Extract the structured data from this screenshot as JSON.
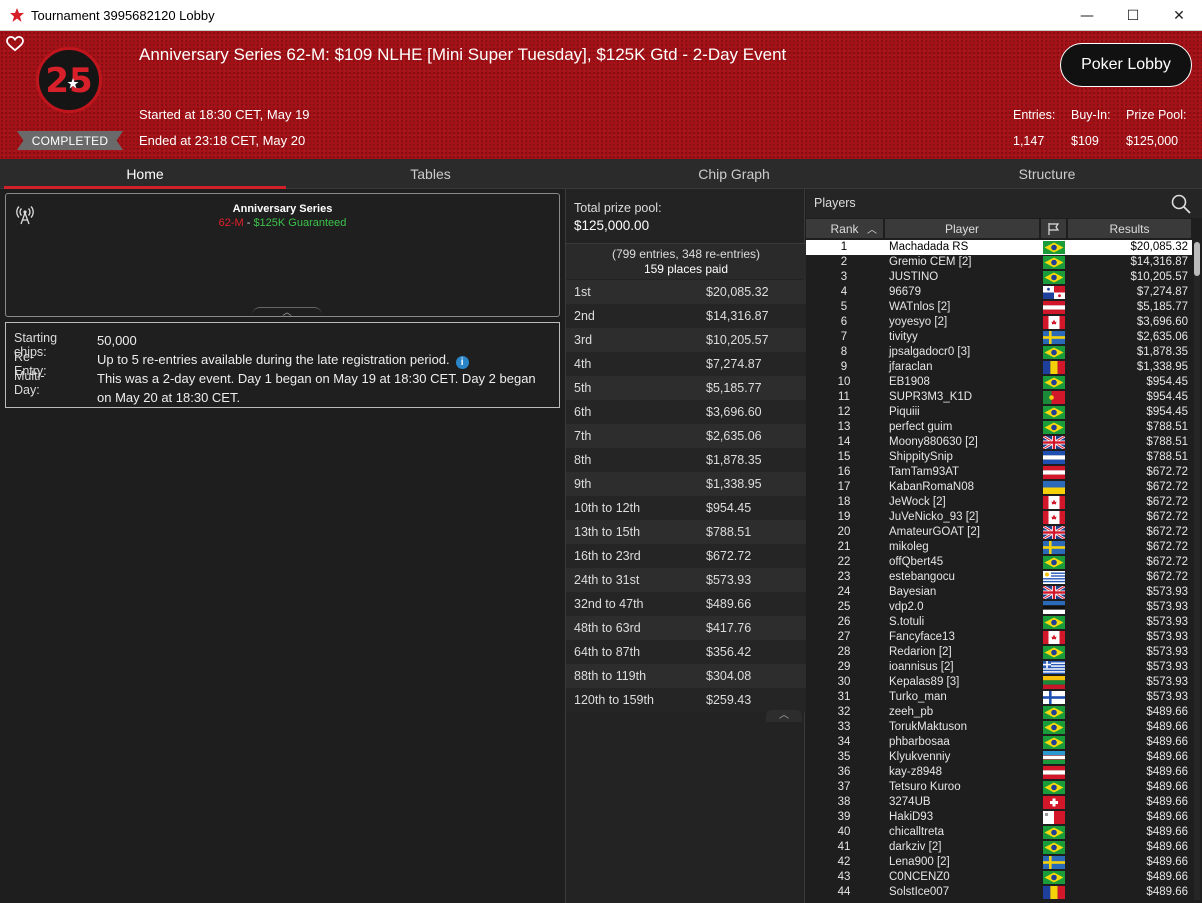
{
  "window": {
    "title": "Tournament 3995682120 Lobby",
    "minimize": "—",
    "maximize": "☐",
    "close": "✕"
  },
  "header": {
    "title": "Anniversary Series 62-M: $109 NLHE [Mini Super Tuesday], $125K Gtd - 2-Day Event",
    "logo_text": "25",
    "status_badge": "COMPLETED",
    "started": "Started at 18:30 CET, May 19",
    "ended": "Ended at 23:18 CET, May 20",
    "poker_lobby_button": "Poker Lobby",
    "entries_label": "Entries:",
    "entries_value": "1,147",
    "buyin_label": "Buy-In:",
    "buyin_value": "$109",
    "prizepool_label": "Prize Pool:",
    "prizepool_value": "$125,000"
  },
  "tabs": [
    "Home",
    "Tables",
    "Chip Graph",
    "Structure"
  ],
  "series": {
    "name": "Anniversary Series",
    "code": "62-M",
    "separator": " - ",
    "guarantee": "$125K Guaranteed"
  },
  "info": {
    "starting_chips_label": "Starting chips:",
    "starting_chips_value": "50,000",
    "reentry_label": "Re-Entry:",
    "reentry_value": "Up to 5 re-entries available during the late registration period.",
    "multiday_label": "Multi-Day:",
    "multiday_value": "This was a 2-day event. Day 1 began on May 19 at 18:30 CET. Day 2 began on May 20 at 18:30 CET."
  },
  "prize_pool": {
    "label": "Total prize pool:",
    "value": "$125,000.00",
    "entries_text": "(799 entries, 348 re-entries)",
    "places_paid": "159 places paid",
    "payouts": [
      {
        "place": "1st",
        "amount": "$20,085.32"
      },
      {
        "place": "2nd",
        "amount": "$14,316.87"
      },
      {
        "place": "3rd",
        "amount": "$10,205.57"
      },
      {
        "place": "4th",
        "amount": "$7,274.87"
      },
      {
        "place": "5th",
        "amount": "$5,185.77"
      },
      {
        "place": "6th",
        "amount": "$3,696.60"
      },
      {
        "place": "7th",
        "amount": "$2,635.06"
      },
      {
        "place": "8th",
        "amount": "$1,878.35"
      },
      {
        "place": "9th",
        "amount": "$1,338.95"
      },
      {
        "place": "10th to 12th",
        "amount": "$954.45"
      },
      {
        "place": "13th to 15th",
        "amount": "$788.51"
      },
      {
        "place": "16th to 23rd",
        "amount": "$672.72"
      },
      {
        "place": "24th to 31st",
        "amount": "$573.93"
      },
      {
        "place": "32nd to 47th",
        "amount": "$489.66"
      },
      {
        "place": "48th to 63rd",
        "amount": "$417.76"
      },
      {
        "place": "64th to 87th",
        "amount": "$356.42"
      },
      {
        "place": "88th to 119th",
        "amount": "$304.08"
      },
      {
        "place": "120th to 159th",
        "amount": "$259.43"
      }
    ]
  },
  "players": {
    "title": "Players",
    "columns": {
      "rank": "Rank",
      "player": "Player",
      "results": "Results"
    },
    "rows": [
      {
        "rank": "1",
        "name": "Machadada RS",
        "flag": "br",
        "result": "$20,085.32"
      },
      {
        "rank": "2",
        "name": "Gremio CEM [2]",
        "flag": "br",
        "result": "$14,316.87"
      },
      {
        "rank": "3",
        "name": "JUSTINO",
        "flag": "br",
        "result": "$10,205.57"
      },
      {
        "rank": "4",
        "name": "96679",
        "flag": "pa",
        "result": "$7,274.87"
      },
      {
        "rank": "5",
        "name": "WATnlos [2]",
        "flag": "at",
        "result": "$5,185.77"
      },
      {
        "rank": "6",
        "name": "yoyesyo [2]",
        "flag": "ca",
        "result": "$3,696.60"
      },
      {
        "rank": "7",
        "name": "tivityy",
        "flag": "se",
        "result": "$2,635.06"
      },
      {
        "rank": "8",
        "name": "jpsalgadocr0 [3]",
        "flag": "br",
        "result": "$1,878.35"
      },
      {
        "rank": "9",
        "name": "jfaraclan",
        "flag": "ro",
        "result": "$1,338.95"
      },
      {
        "rank": "10",
        "name": "EB1908",
        "flag": "br",
        "result": "$954.45"
      },
      {
        "rank": "11",
        "name": "SUPR3M3_K1D",
        "flag": "pt",
        "result": "$954.45"
      },
      {
        "rank": "12",
        "name": "Piquiii",
        "flag": "br",
        "result": "$954.45"
      },
      {
        "rank": "13",
        "name": "perfect guim",
        "flag": "br",
        "result": "$788.51"
      },
      {
        "rank": "14",
        "name": "Moony880630 [2]",
        "flag": "gb",
        "result": "$788.51"
      },
      {
        "rank": "15",
        "name": "ShippitySnip",
        "flag": "sv",
        "result": "$788.51"
      },
      {
        "rank": "16",
        "name": "TamTam93AT",
        "flag": "at",
        "result": "$672.72"
      },
      {
        "rank": "17",
        "name": "KabanRomaN08",
        "flag": "ua",
        "result": "$672.72"
      },
      {
        "rank": "18",
        "name": "JeWock [2]",
        "flag": "ca",
        "result": "$672.72"
      },
      {
        "rank": "19",
        "name": "JuVeNicko_93 [2]",
        "flag": "ca",
        "result": "$672.72"
      },
      {
        "rank": "20",
        "name": "AmateurGOAT [2]",
        "flag": "gb",
        "result": "$672.72"
      },
      {
        "rank": "21",
        "name": "mikoleg",
        "flag": "se",
        "result": "$672.72"
      },
      {
        "rank": "22",
        "name": "offQbert45",
        "flag": "br",
        "result": "$672.72"
      },
      {
        "rank": "23",
        "name": "estebangocu",
        "flag": "uy",
        "result": "$672.72"
      },
      {
        "rank": "24",
        "name": "Bayesian",
        "flag": "gb",
        "result": "$573.93"
      },
      {
        "rank": "25",
        "name": "vdp2.0",
        "flag": "ee",
        "result": "$573.93"
      },
      {
        "rank": "26",
        "name": "S.totuli",
        "flag": "br",
        "result": "$573.93"
      },
      {
        "rank": "27",
        "name": "Fancyface13",
        "flag": "ca",
        "result": "$573.93"
      },
      {
        "rank": "28",
        "name": "Redarion [2]",
        "flag": "br",
        "result": "$573.93"
      },
      {
        "rank": "29",
        "name": "ioannisus [2]",
        "flag": "gr",
        "result": "$573.93"
      },
      {
        "rank": "30",
        "name": "Kepalas89 [3]",
        "flag": "lt",
        "result": "$573.93"
      },
      {
        "rank": "31",
        "name": "Turko_man",
        "flag": "fi",
        "result": "$573.93"
      },
      {
        "rank": "32",
        "name": "zeeh_pb",
        "flag": "br",
        "result": "$489.66"
      },
      {
        "rank": "33",
        "name": "TorukMaktuson",
        "flag": "br",
        "result": "$489.66"
      },
      {
        "rank": "34",
        "name": "phbarbosaa",
        "flag": "br",
        "result": "$489.66"
      },
      {
        "rank": "35",
        "name": "Klyukvenniy",
        "flag": "uz",
        "result": "$489.66"
      },
      {
        "rank": "36",
        "name": "kay-z8948",
        "flag": "at",
        "result": "$489.66"
      },
      {
        "rank": "37",
        "name": "Tetsuro Kuroo",
        "flag": "br",
        "result": "$489.66"
      },
      {
        "rank": "38",
        "name": "3274UB",
        "flag": "ch",
        "result": "$489.66"
      },
      {
        "rank": "39",
        "name": "HakiD93",
        "flag": "mt",
        "result": "$489.66"
      },
      {
        "rank": "40",
        "name": "chicalltreta",
        "flag": "br",
        "result": "$489.66"
      },
      {
        "rank": "41",
        "name": "darkziv [2]",
        "flag": "br",
        "result": "$489.66"
      },
      {
        "rank": "42",
        "name": "Lena900 [2]",
        "flag": "se",
        "result": "$489.66"
      },
      {
        "rank": "43",
        "name": "C0NCENZ0",
        "flag": "br",
        "result": "$489.66"
      },
      {
        "rank": "44",
        "name": "SolstIce007",
        "flag": "ro",
        "result": "$489.66"
      }
    ]
  },
  "colors": {
    "header_red": "#a31016",
    "accent_red": "#d0202a",
    "guarantee_green": "#3cc24a",
    "selected_row": "#ffffff"
  }
}
